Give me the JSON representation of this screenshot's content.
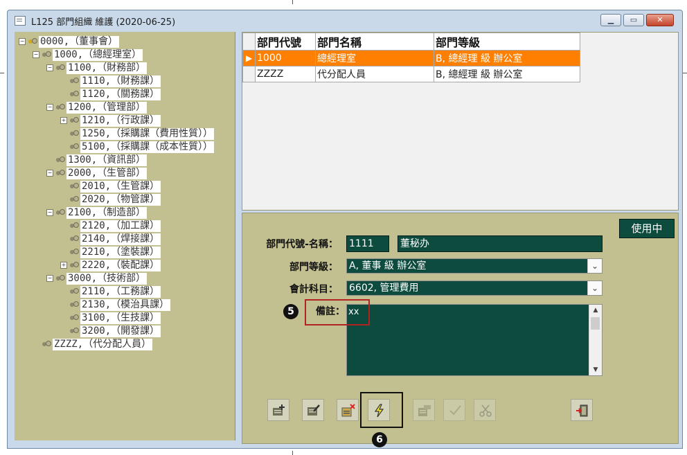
{
  "window": {
    "title": "L125 部門組織 維護 (2020-06-25)",
    "minimize_icon": "minimize-icon",
    "restore_icon": "restore-icon",
    "close_icon": "close-icon"
  },
  "tree": {
    "nodes": [
      {
        "label": "0000,（董事會）",
        "expander": "−"
      },
      {
        "label": "1000,（總經理室）",
        "expander": "−"
      },
      {
        "label": "1100,（財務部）",
        "expander": "−"
      },
      {
        "label": "1110,（財務課）",
        "expander": ""
      },
      {
        "label": "1120,（關務課）",
        "expander": ""
      },
      {
        "label": "1200,（管理部）",
        "expander": "−"
      },
      {
        "label": "1210,（行政課）",
        "expander": "+"
      },
      {
        "label": "1250,（採購課（費用性質））",
        "expander": ""
      },
      {
        "label": "5100,（採購課（成本性質））",
        "expander": ""
      },
      {
        "label": "1300,（資訊部）",
        "expander": ""
      },
      {
        "label": "2000,（生管部）",
        "expander": "−"
      },
      {
        "label": "2010,（生管課）",
        "expander": ""
      },
      {
        "label": "2020,（物管課）",
        "expander": ""
      },
      {
        "label": "2100,（制造部）",
        "expander": "−"
      },
      {
        "label": "2120,（加工課）",
        "expander": ""
      },
      {
        "label": "2140,（焊接課）",
        "expander": ""
      },
      {
        "label": "2210,（塗裝課）",
        "expander": ""
      },
      {
        "label": "2220,（裝配課）",
        "expander": "+"
      },
      {
        "label": "3000,（技術部）",
        "expander": "−"
      },
      {
        "label": "2110,（工務課）",
        "expander": ""
      },
      {
        "label": "2130,（模治具課）",
        "expander": ""
      },
      {
        "label": "3100,（生技課）",
        "expander": ""
      },
      {
        "label": "3200,（開發課）",
        "expander": ""
      },
      {
        "label": "ZZZZ,（代分配人員）",
        "expander": ""
      }
    ]
  },
  "grid": {
    "columns": [
      "部門代號",
      "部門名稱",
      "部門等級"
    ],
    "rows": [
      {
        "indicator": "▶",
        "code": "1000",
        "name": "總經理室",
        "level": "B, 總經理 級 辦公室",
        "selected": true
      },
      {
        "indicator": "",
        "code": "ZZZZ",
        "name": "代分配人員",
        "level": "B, 總經理 級 辦公室",
        "selected": false
      }
    ]
  },
  "form": {
    "status": "使用中",
    "code_name_label": "部門代號-名稱：",
    "code_value": "1111",
    "name_value": "董秘办",
    "level_label": "部門等級：",
    "level_value": "A, 董事 級 辦公室",
    "account_label": "會計科目：",
    "account_value": "6602, 管理費用",
    "remark_label": "備註：",
    "remark_value": "xx",
    "combo_arrow_icon": "chevron-down-icon"
  },
  "toolbar": {
    "buttons": [
      {
        "name": "add-record-icon",
        "enabled": true
      },
      {
        "name": "edit-record-icon",
        "enabled": true
      },
      {
        "name": "delete-record-icon",
        "enabled": true
      },
      {
        "name": "lightning-icon",
        "enabled": true
      },
      {
        "name": "copy-record-icon",
        "enabled": false
      },
      {
        "name": "confirm-check-icon",
        "enabled": false
      },
      {
        "name": "cancel-scissors-icon",
        "enabled": false
      },
      {
        "name": "exit-door-icon",
        "enabled": true
      }
    ]
  },
  "annotations": {
    "badge5": "5",
    "badge6": "6"
  },
  "colors": {
    "client_bg": "#c2bf90",
    "field_bg": "#0d4b3f",
    "selected_row": "#ff7f00",
    "title_bar": "#c9d9ea"
  }
}
